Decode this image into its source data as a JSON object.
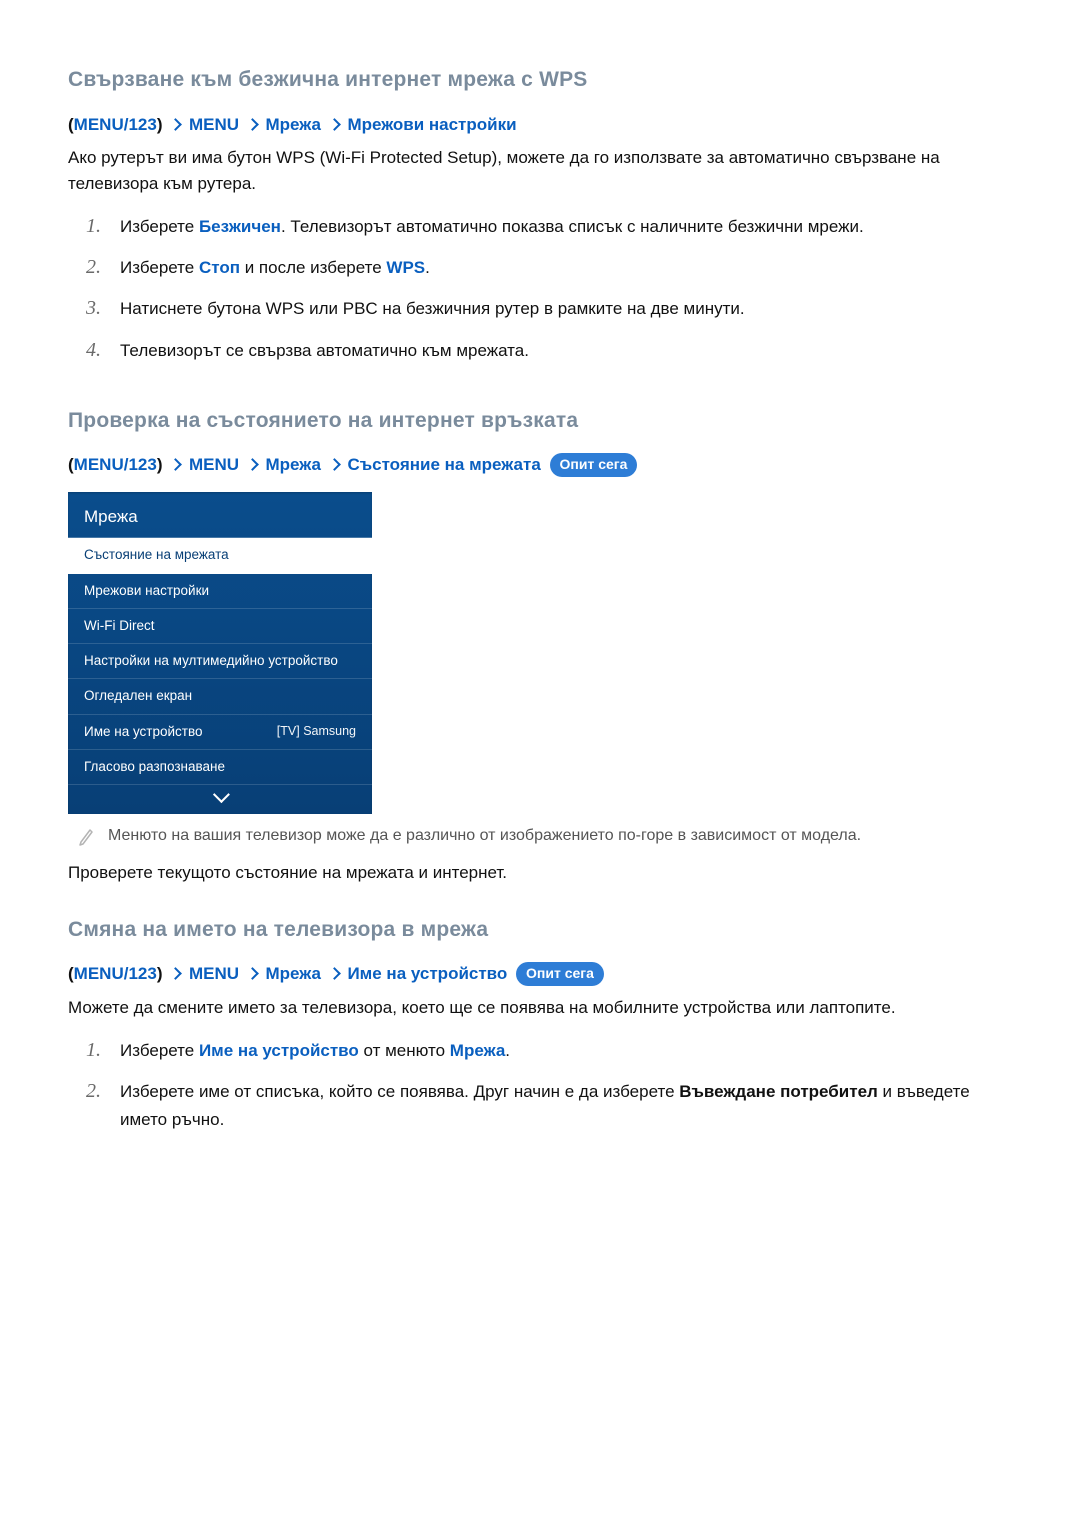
{
  "sections": {
    "wps": {
      "heading": "Свързване към безжична интернет мрежа с WPS",
      "crumb": {
        "p1": "(",
        "c1": "MENU/123",
        "p2": ")",
        "c2": "MENU",
        "c3": "Мрежа",
        "c4": "Мрежови настройки"
      },
      "intro": "Ако рутерът ви има бутон WPS (Wi-Fi Protected Setup), можете да го използвате за автоматично свързване на телевизора към рутера.",
      "steps": [
        {
          "n": "1.",
          "pre": "Изберете ",
          "hl1": "Безжичен",
          "post": ". Телевизорът автоматично показва списък с наличните безжични мрежи."
        },
        {
          "n": "2.",
          "pre": "Изберете ",
          "hl1": "Стоп",
          "mid": " и после изберете ",
          "hl2": "WPS",
          "post": "."
        },
        {
          "n": "3.",
          "text": "Натиснете бутона WPS или PBC на безжичния рутер в рамките на две минути."
        },
        {
          "n": "4.",
          "text": "Телевизорът се свързва автоматично към мрежата."
        }
      ]
    },
    "status": {
      "heading": "Проверка на състоянието на интернет връзката",
      "crumb": {
        "p1": "(",
        "c1": "MENU/123",
        "p2": ")",
        "c2": "MENU",
        "c3": "Мрежа",
        "c4": "Състояние на мрежата",
        "try": "Опит сега"
      },
      "menu": {
        "title": "Мрежа",
        "items": [
          {
            "label": "Състояние на мрежата",
            "selected": true
          },
          {
            "label": "Мрежови настройки"
          },
          {
            "label": "Wi-Fi Direct"
          },
          {
            "label": "Настройки на мултимедийно устройство"
          },
          {
            "label": "Огледален екран"
          },
          {
            "label": "Име на устройство",
            "value": "[TV] Samsung"
          },
          {
            "label": "Гласово разпознаване"
          }
        ]
      },
      "note": "Менюто на вашия телевизор може да е различно от изображението по-горе в зависимост от модела.",
      "body": "Проверете текущото състояние на мрежата и интернет."
    },
    "rename": {
      "heading": "Смяна на името на телевизора в мрежа",
      "crumb": {
        "p1": "(",
        "c1": "MENU/123",
        "p2": ")",
        "c2": "MENU",
        "c3": "Мрежа",
        "c4": "Име на устройство",
        "try": "Опит сега"
      },
      "intro": "Можете да смените името за телевизора, което ще се появява на мобилните устройства или лаптопите.",
      "steps": [
        {
          "n": "1.",
          "pre": "Изберете ",
          "hl1": "Име на устройство",
          "mid": " от менюто ",
          "hl2": "Мрежа",
          "post": "."
        },
        {
          "n": "2.",
          "pre": "Изберете име от списъка, който се появява. Друг начин е да изберете ",
          "hl1": "Въвеждане потребител",
          "post": " и въведете името ръчно."
        }
      ]
    }
  }
}
